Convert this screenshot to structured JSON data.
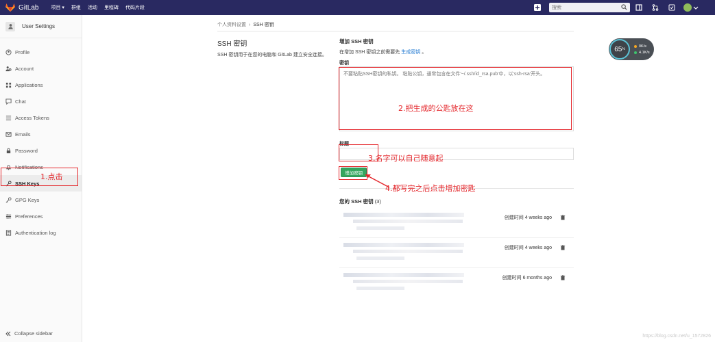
{
  "navbar": {
    "brand": "GitLab",
    "links": [
      "项目 ▾",
      "群组",
      "活动",
      "里程碑",
      "代码片段"
    ],
    "search_placeholder": "搜索"
  },
  "sidebar": {
    "title": "User Settings",
    "items": [
      {
        "label": "Profile",
        "icon": "profile-icon"
      },
      {
        "label": "Account",
        "icon": "account-icon"
      },
      {
        "label": "Applications",
        "icon": "applications-icon"
      },
      {
        "label": "Chat",
        "icon": "chat-icon"
      },
      {
        "label": "Access Tokens",
        "icon": "token-icon"
      },
      {
        "label": "Emails",
        "icon": "email-icon"
      },
      {
        "label": "Password",
        "icon": "lock-icon"
      },
      {
        "label": "Notifications",
        "icon": "bell-icon"
      },
      {
        "label": "SSH Keys",
        "icon": "key-icon",
        "active": true
      },
      {
        "label": "GPG Keys",
        "icon": "key-icon"
      },
      {
        "label": "Preferences",
        "icon": "preferences-icon"
      },
      {
        "label": "Authentication log",
        "icon": "log-icon"
      }
    ],
    "collapse_label": "Collapse sidebar"
  },
  "breadcrumb": {
    "parent": "个人资料设置",
    "current": "SSH 密钥"
  },
  "intro": {
    "title": "SSH 密钥",
    "description": "SSH 密钥用于在您的电脑和 GitLab 建立安全连接。"
  },
  "add_form": {
    "title": "增加 SSH 密钥",
    "hint_prefix": "在增加 SSH 密钥之前需要先",
    "hint_link": "生成密钥",
    "hint_suffix": "。",
    "key_label": "密钥",
    "key_placeholder": "不要粘贴SSH密钥的私钥。 粘贴公钥，通常包含在文件'~/.ssh/id_rsa.pub'中，以'ssh-rsa'开头。",
    "title_label": "标题",
    "submit_label": "增加密钥"
  },
  "keys_list": {
    "title": "您的 SSH 密钥",
    "count": "(3)",
    "keys": [
      {
        "created": "创建时间 4 weeks ago"
      },
      {
        "created": "创建时间 4 weeks ago"
      },
      {
        "created": "创建时间 6 months ago"
      }
    ]
  },
  "annotations": {
    "step1": "1.点击",
    "step2": "2.把生成的公匙放在这",
    "step3": "3.名字可以自己随意起",
    "step4": "4.都写完之后点击增加密匙"
  },
  "speed_widget": {
    "percent": "65",
    "percent_unit": "%",
    "up": "0K/s",
    "down": "4.1K/s"
  },
  "watermark": "https://blog.csdn.net/u_1572826"
}
